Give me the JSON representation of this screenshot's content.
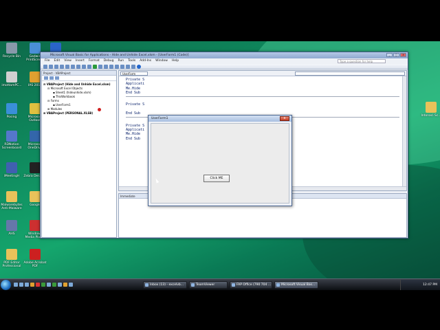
{
  "desktop": {
    "icons": [
      {
        "label": "Recycle Bin",
        "color": "#8899aa"
      },
      {
        "label": "Gadwin PrintScreen",
        "color": "#4a8fd6"
      },
      {
        "label": "Malwarebyt... Anti-Malware",
        "color": "#2a64c8"
      },
      {
        "label": "imottamPC...",
        "color": "#d0d0d0"
      },
      {
        "label": "IAS 2013",
        "color": "#e0a030"
      },
      {
        "label": "folder",
        "color": "#e8c25a"
      },
      {
        "label": "Posing",
        "color": "#3a8fd8"
      },
      {
        "label": "Microsoft Outlook",
        "color": "#e0c040"
      },
      {
        "label": "Intonaci Sc...",
        "color": "#e8c25a"
      },
      {
        "label": "RDNation Screenboard",
        "color": "#5577cc"
      },
      {
        "label": "Microsoft OneDrive",
        "color": "#3366aa"
      },
      {
        "label": "iMeetingH",
        "color": "#4060b0"
      },
      {
        "label": "Zebra Desktop",
        "color": "#222222"
      },
      {
        "label": "Malwarebytes Anti-Malware",
        "color": "#e8c25a"
      },
      {
        "label": "Google",
        "color": "#e8c25a"
      },
      {
        "label": "AHS",
        "color": "#6677aa"
      },
      {
        "label": "Windows Media Player",
        "color": "#cc3030"
      },
      {
        "label": "PDF Editor Professional",
        "color": "#e8c25a"
      },
      {
        "label": "Adobe Acrobat PDF",
        "color": "#cc2020"
      }
    ]
  },
  "vbe": {
    "title": "Microsoft Visual Basic for Applications - Hide and Unhide Excel.xlsm - [UserForm1 (Code)]",
    "menu": [
      "File",
      "Edit",
      "View",
      "Insert",
      "Format",
      "Debug",
      "Run",
      "Tools",
      "Add-Ins",
      "Window",
      "Help"
    ],
    "help_placeholder": "Type a question for help",
    "project_pane_title": "Project - VBAProject",
    "tree": [
      "VBAProject (Hide and Unhide Excel.xlsm)",
      "Microsoft Excel Objects",
      "Sheet1 (hideunhide.xlsm)",
      "ThisWorkbook",
      "Forms",
      "UserForm1",
      "Modules",
      "VBAProject (PERSONAL.XLSB)"
    ],
    "code_object": "UserForm",
    "code_lines": [
      "Private S",
      "Applicati",
      "Me.Hide",
      "End Sub",
      "",
      "Private S",
      "",
      "End Sub",
      "",
      "Private S",
      "Applicati",
      "Me.Hide",
      "End Sub"
    ],
    "immediate_title": "Immediate"
  },
  "userform": {
    "title": "UserForm1",
    "button_label": "Click ME"
  },
  "taskbar": {
    "tasks": [
      "Inbox (13) - excelvb...",
      "TeamViewer",
      "FAP Office (790 704 ...",
      "Microsoft Visual Bas..."
    ],
    "clock": "12:47 PM"
  }
}
